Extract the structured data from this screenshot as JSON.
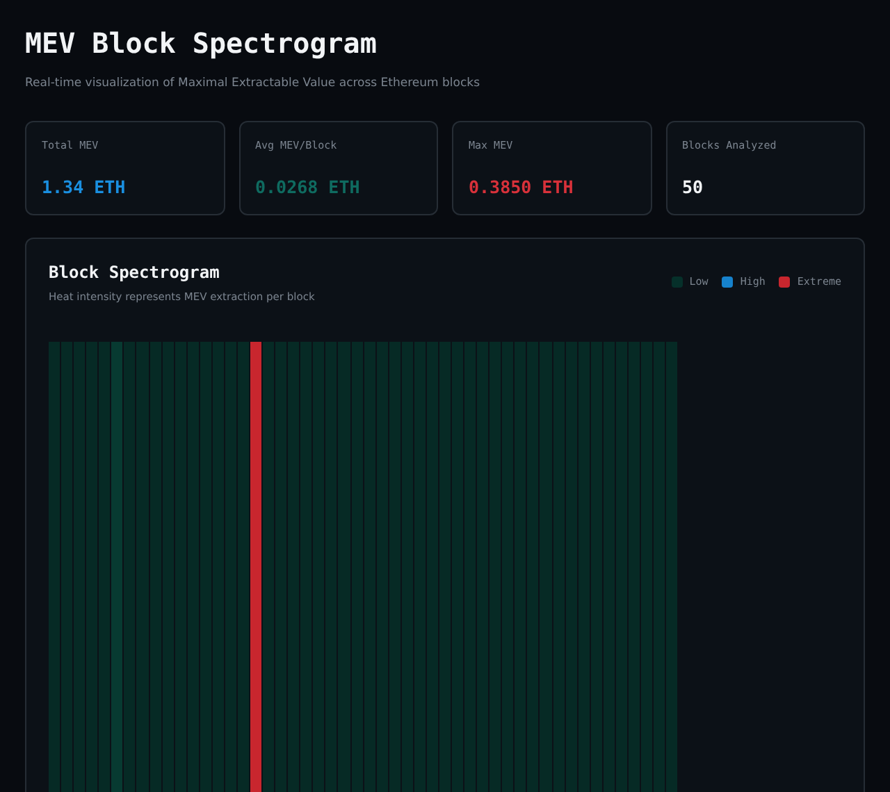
{
  "header": {
    "title": "MEV Block Spectrogram",
    "subtitle": "Real-time visualization of Maximal Extractable Value across Ethereum blocks"
  },
  "stats": [
    {
      "label": "Total MEV",
      "value": "1.34 ETH",
      "color": "#1a8fe0"
    },
    {
      "label": "Avg MEV/Block",
      "value": "0.0268 ETH",
      "color": "#0f6b60"
    },
    {
      "label": "Max MEV",
      "value": "0.3850 ETH",
      "color": "#d8313a"
    },
    {
      "label": "Blocks Analyzed",
      "value": "50",
      "color": "#f2f4f6"
    }
  ],
  "panel": {
    "title": "Block Spectrogram",
    "subtitle": "Heat intensity represents MEV extraction per block",
    "legend": [
      {
        "label": "Low",
        "color": "#06302a"
      },
      {
        "label": "High",
        "color": "#1682cc"
      },
      {
        "label": "Extreme",
        "color": "#c8262e"
      }
    ],
    "blocks": [
      {
        "color": "#062a25"
      },
      {
        "color": "#062a25"
      },
      {
        "color": "#062a25"
      },
      {
        "color": "#062a25"
      },
      {
        "color": "#062a25"
      },
      {
        "color": "#073a31"
      },
      {
        "color": "#062a25"
      },
      {
        "color": "#062a25"
      },
      {
        "color": "#062a25"
      },
      {
        "color": "#062a25"
      },
      {
        "color": "#062a25"
      },
      {
        "color": "#062a25"
      },
      {
        "color": "#062a25"
      },
      {
        "color": "#062a25"
      },
      {
        "color": "#062a25"
      },
      {
        "color": "#062a25"
      },
      {
        "color": "#c8262e"
      },
      {
        "color": "#062a25"
      },
      {
        "color": "#062a25"
      },
      {
        "color": "#062a25"
      },
      {
        "color": "#062a25"
      },
      {
        "color": "#062a25"
      },
      {
        "color": "#062a25"
      },
      {
        "color": "#062a25"
      },
      {
        "color": "#062a25"
      },
      {
        "color": "#062a25"
      },
      {
        "color": "#062a25"
      },
      {
        "color": "#062a25"
      },
      {
        "color": "#062a25"
      },
      {
        "color": "#062a25"
      },
      {
        "color": "#062a25"
      },
      {
        "color": "#062a25"
      },
      {
        "color": "#062a25"
      },
      {
        "color": "#062a25"
      },
      {
        "color": "#062a25"
      },
      {
        "color": "#062a25"
      },
      {
        "color": "#062a25"
      },
      {
        "color": "#062a25"
      },
      {
        "color": "#062a25"
      },
      {
        "color": "#062a25"
      },
      {
        "color": "#062a25"
      },
      {
        "color": "#062a25"
      },
      {
        "color": "#062a25"
      },
      {
        "color": "#062a25"
      },
      {
        "color": "#062a25"
      },
      {
        "color": "#062a25"
      },
      {
        "color": "#062a25"
      },
      {
        "color": "#062a25"
      },
      {
        "color": "#062a25"
      },
      {
        "color": "#062a25"
      }
    ]
  }
}
